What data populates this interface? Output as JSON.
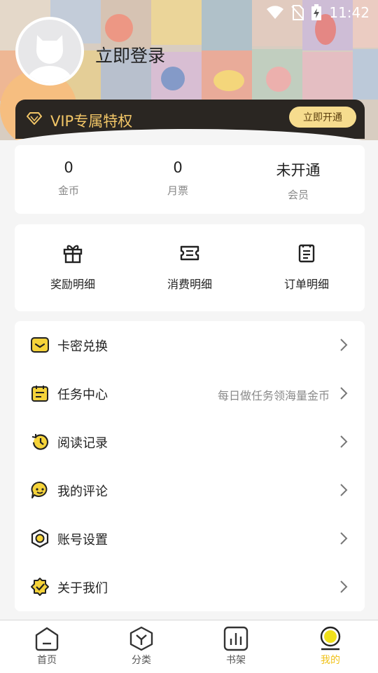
{
  "status_bar": {
    "time": "11:42"
  },
  "profile": {
    "login_label": "立即登录"
  },
  "vip": {
    "label": "VIP专属特权",
    "button": "立即开通"
  },
  "stats": [
    {
      "value": "0",
      "label": "金币"
    },
    {
      "value": "0",
      "label": "月票"
    },
    {
      "value": "未开通",
      "label": "会员"
    }
  ],
  "records": [
    {
      "label": "奖励明细",
      "icon": "gift-icon"
    },
    {
      "label": "消费明细",
      "icon": "ticket-icon"
    },
    {
      "label": "订单明细",
      "icon": "order-list-icon"
    }
  ],
  "menu": [
    {
      "label": "卡密兑换",
      "icon": "card-key-icon",
      "hint": ""
    },
    {
      "label": "任务中心",
      "icon": "calendar-task-icon",
      "hint": "每日做任务领海量金币"
    },
    {
      "label": "阅读记录",
      "icon": "history-clock-icon",
      "hint": ""
    },
    {
      "label": "我的评论",
      "icon": "comment-icon",
      "hint": ""
    },
    {
      "label": "账号设置",
      "icon": "settings-hex-icon",
      "hint": ""
    },
    {
      "label": "关于我们",
      "icon": "badge-check-icon",
      "hint": ""
    }
  ],
  "nav": [
    {
      "label": "首页",
      "icon": "home-icon",
      "active": false
    },
    {
      "label": "分类",
      "icon": "category-cube-icon",
      "active": false
    },
    {
      "label": "书架",
      "icon": "bookshelf-icon",
      "active": false
    },
    {
      "label": "我的",
      "icon": "profile-icon",
      "active": true
    }
  ],
  "colors": {
    "accent": "#f0c21a",
    "vip_bg": "#2a2622",
    "vip_text": "#f2c667",
    "vip_button": "#f6dc8e"
  }
}
